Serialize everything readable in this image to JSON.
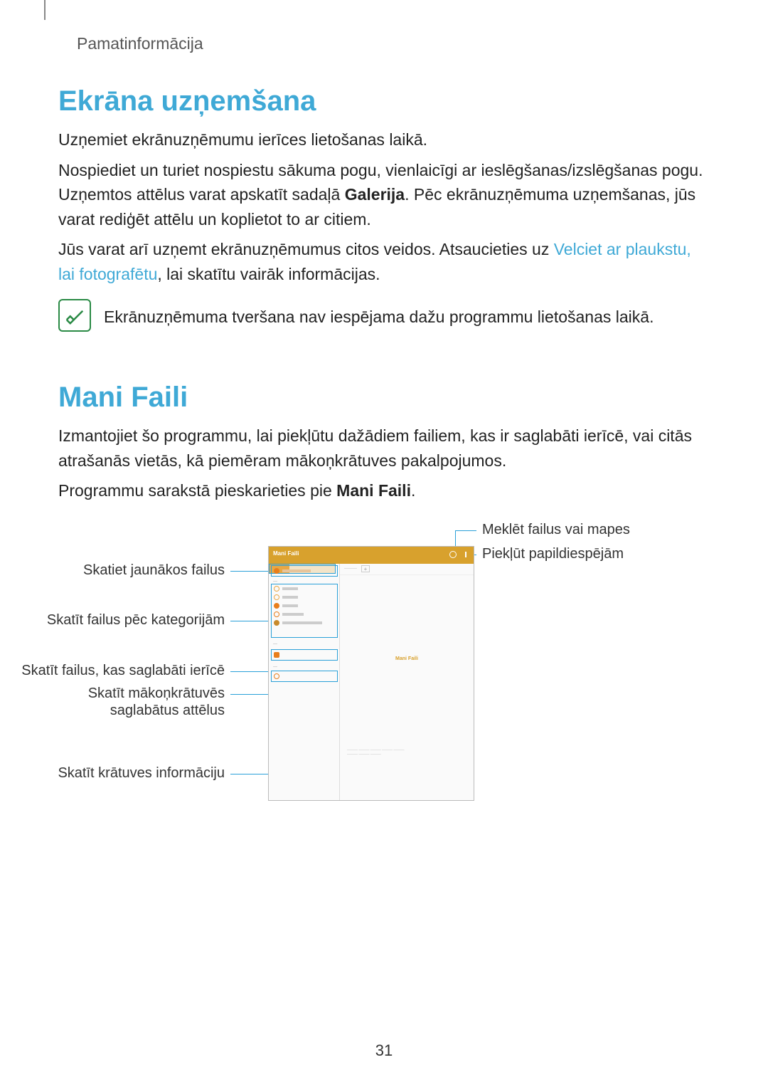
{
  "header": {
    "breadcrumb": "Pamatinformācija"
  },
  "section1": {
    "title": "Ekrāna uzņemšana",
    "p1": "Uzņemiet ekrānuzņēmumu ierīces lietošanas laikā.",
    "p2_a": "Nospiediet un turiet nospiestu sākuma pogu, vienlaicīgi ar ieslēgšanas/izslēgšanas pogu. Uzņemtos attēlus varat apskatīt sadaļā ",
    "p2_bold": "Galerija",
    "p2_b": ". Pēc ekrānuzņēmuma uzņemšanas, jūs varat rediģēt attēlu un koplietot to ar citiem.",
    "p3_a": "Jūs varat arī uzņemt ekrānuzņēmumus citos veidos. Atsaucieties uz ",
    "p3_link": "Velciet ar plaukstu, lai fotografētu",
    "p3_b": ", lai skatītu vairāk informācijas.",
    "note": "Ekrānuzņēmuma tveršana nav iespējama dažu programmu lietošanas laikā."
  },
  "section2": {
    "title": "Mani Faili",
    "p1": "Izmantojiet šo programmu, lai piekļūtu dažādiem failiem, kas ir saglabāti ierīcē, vai citās atrašanās vietās, kā piemēram mākoņkrātuves pakalpojumos.",
    "p2_a": "Programmu sarakstā pieskarieties pie ",
    "p2_bold": "Mani Faili",
    "p2_b": "."
  },
  "callouts": {
    "search": "Meklēt failus vai mapes",
    "options": "Piekļūt papildiespējām",
    "recent": "Skatiet jaunākos failus",
    "categories": "Skatīt failus pēc kategorijām",
    "local": "Skatīt failus, kas saglabāti ierīcē",
    "cloud1": "Skatīt mākoņkrātuvēs",
    "cloud2": "saglabātus attēlus",
    "storage": "Skatīt krātuves informāciju"
  },
  "phone": {
    "title": "Mani Faili",
    "center": "Mani Faili"
  },
  "page": "31"
}
